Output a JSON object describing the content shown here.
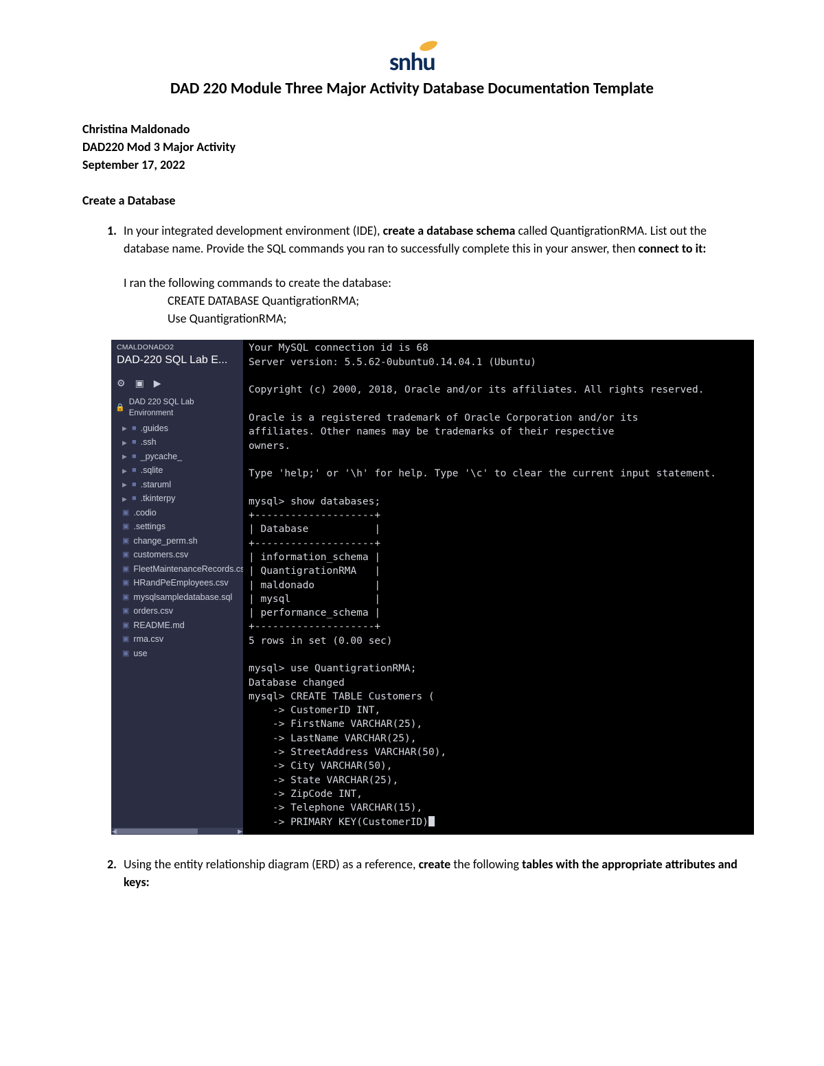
{
  "logo": {
    "text": "snhu"
  },
  "title": "DAD 220 Module Three Major Activity Database Documentation Template",
  "meta": {
    "name": "Christina Maldonado",
    "course": "DAD220 Mod 3 Major Activity",
    "date": "September 17, 2022"
  },
  "section1_heading": "Create a Database",
  "q1": {
    "prefix": "In your integrated development environment (IDE), ",
    "bold1": "create a database schema",
    "mid1": " called QuantigrationRMA. List out the database name. Provide the SQL commands you ran to successfully complete this in your answer, then ",
    "bold2": "connect to it:",
    "answer_intro": "I ran the following commands to create the database:",
    "cmd1": "CREATE DATABASE QuantigrationRMA;",
    "cmd2": "Use QuantigrationRMA;"
  },
  "q2": {
    "prefix": "Using the entity relationship diagram (ERD) as a reference, ",
    "bold1": "create",
    "mid1": " the following ",
    "bold2": "tables with the appropriate attributes and keys:"
  },
  "ide": {
    "user": "CMALDONADO2",
    "title": "DAD-220 SQL Lab E...",
    "lock_label": "DAD 220 SQL Lab Environment",
    "toolbar": {
      "gear": "⚙",
      "stop": "▣",
      "play": "▶"
    },
    "folders": [
      ".guides",
      ".ssh",
      "_pycache_",
      ".sqlite",
      ".staruml",
      ".tkinterpy"
    ],
    "files": [
      ".codio",
      ".settings",
      "change_perm.sh",
      "customers.csv",
      "FleetMaintenanceRecords.cs",
      "HRandPeEmployees.csv",
      "mysqlsampledatabase.sql",
      "orders.csv",
      "README.md",
      "rma.csv",
      "use"
    ],
    "terminal_text": "Your MySQL connection id is 68\nServer version: 5.5.62-0ubuntu0.14.04.1 (Ubuntu)\n\nCopyright (c) 2000, 2018, Oracle and/or its affiliates. All rights reserved.\n\nOracle is a registered trademark of Oracle Corporation and/or its\naffiliates. Other names may be trademarks of their respective\nowners.\n\nType 'help;' or '\\h' for help. Type '\\c' to clear the current input statement.\n\nmysql> show databases;\n+--------------------+\n| Database           |\n+--------------------+\n| information_schema |\n| QuantigrationRMA   |\n| maldonado          |\n| mysql              |\n| performance_schema |\n+--------------------+\n5 rows in set (0.00 sec)\n\nmysql> use QuantigrationRMA;\nDatabase changed\nmysql> CREATE TABLE Customers (\n    -> CustomerID INT,\n    -> FirstName VARCHAR(25),\n    -> LastName VARCHAR(25),\n    -> StreetAddress VARCHAR(50),\n    -> City VARCHAR(50),\n    -> State VARCHAR(25),\n    -> ZipCode INT,\n    -> Telephone VARCHAR(15),\n    -> PRIMARY KEY(CustomerID)"
  }
}
